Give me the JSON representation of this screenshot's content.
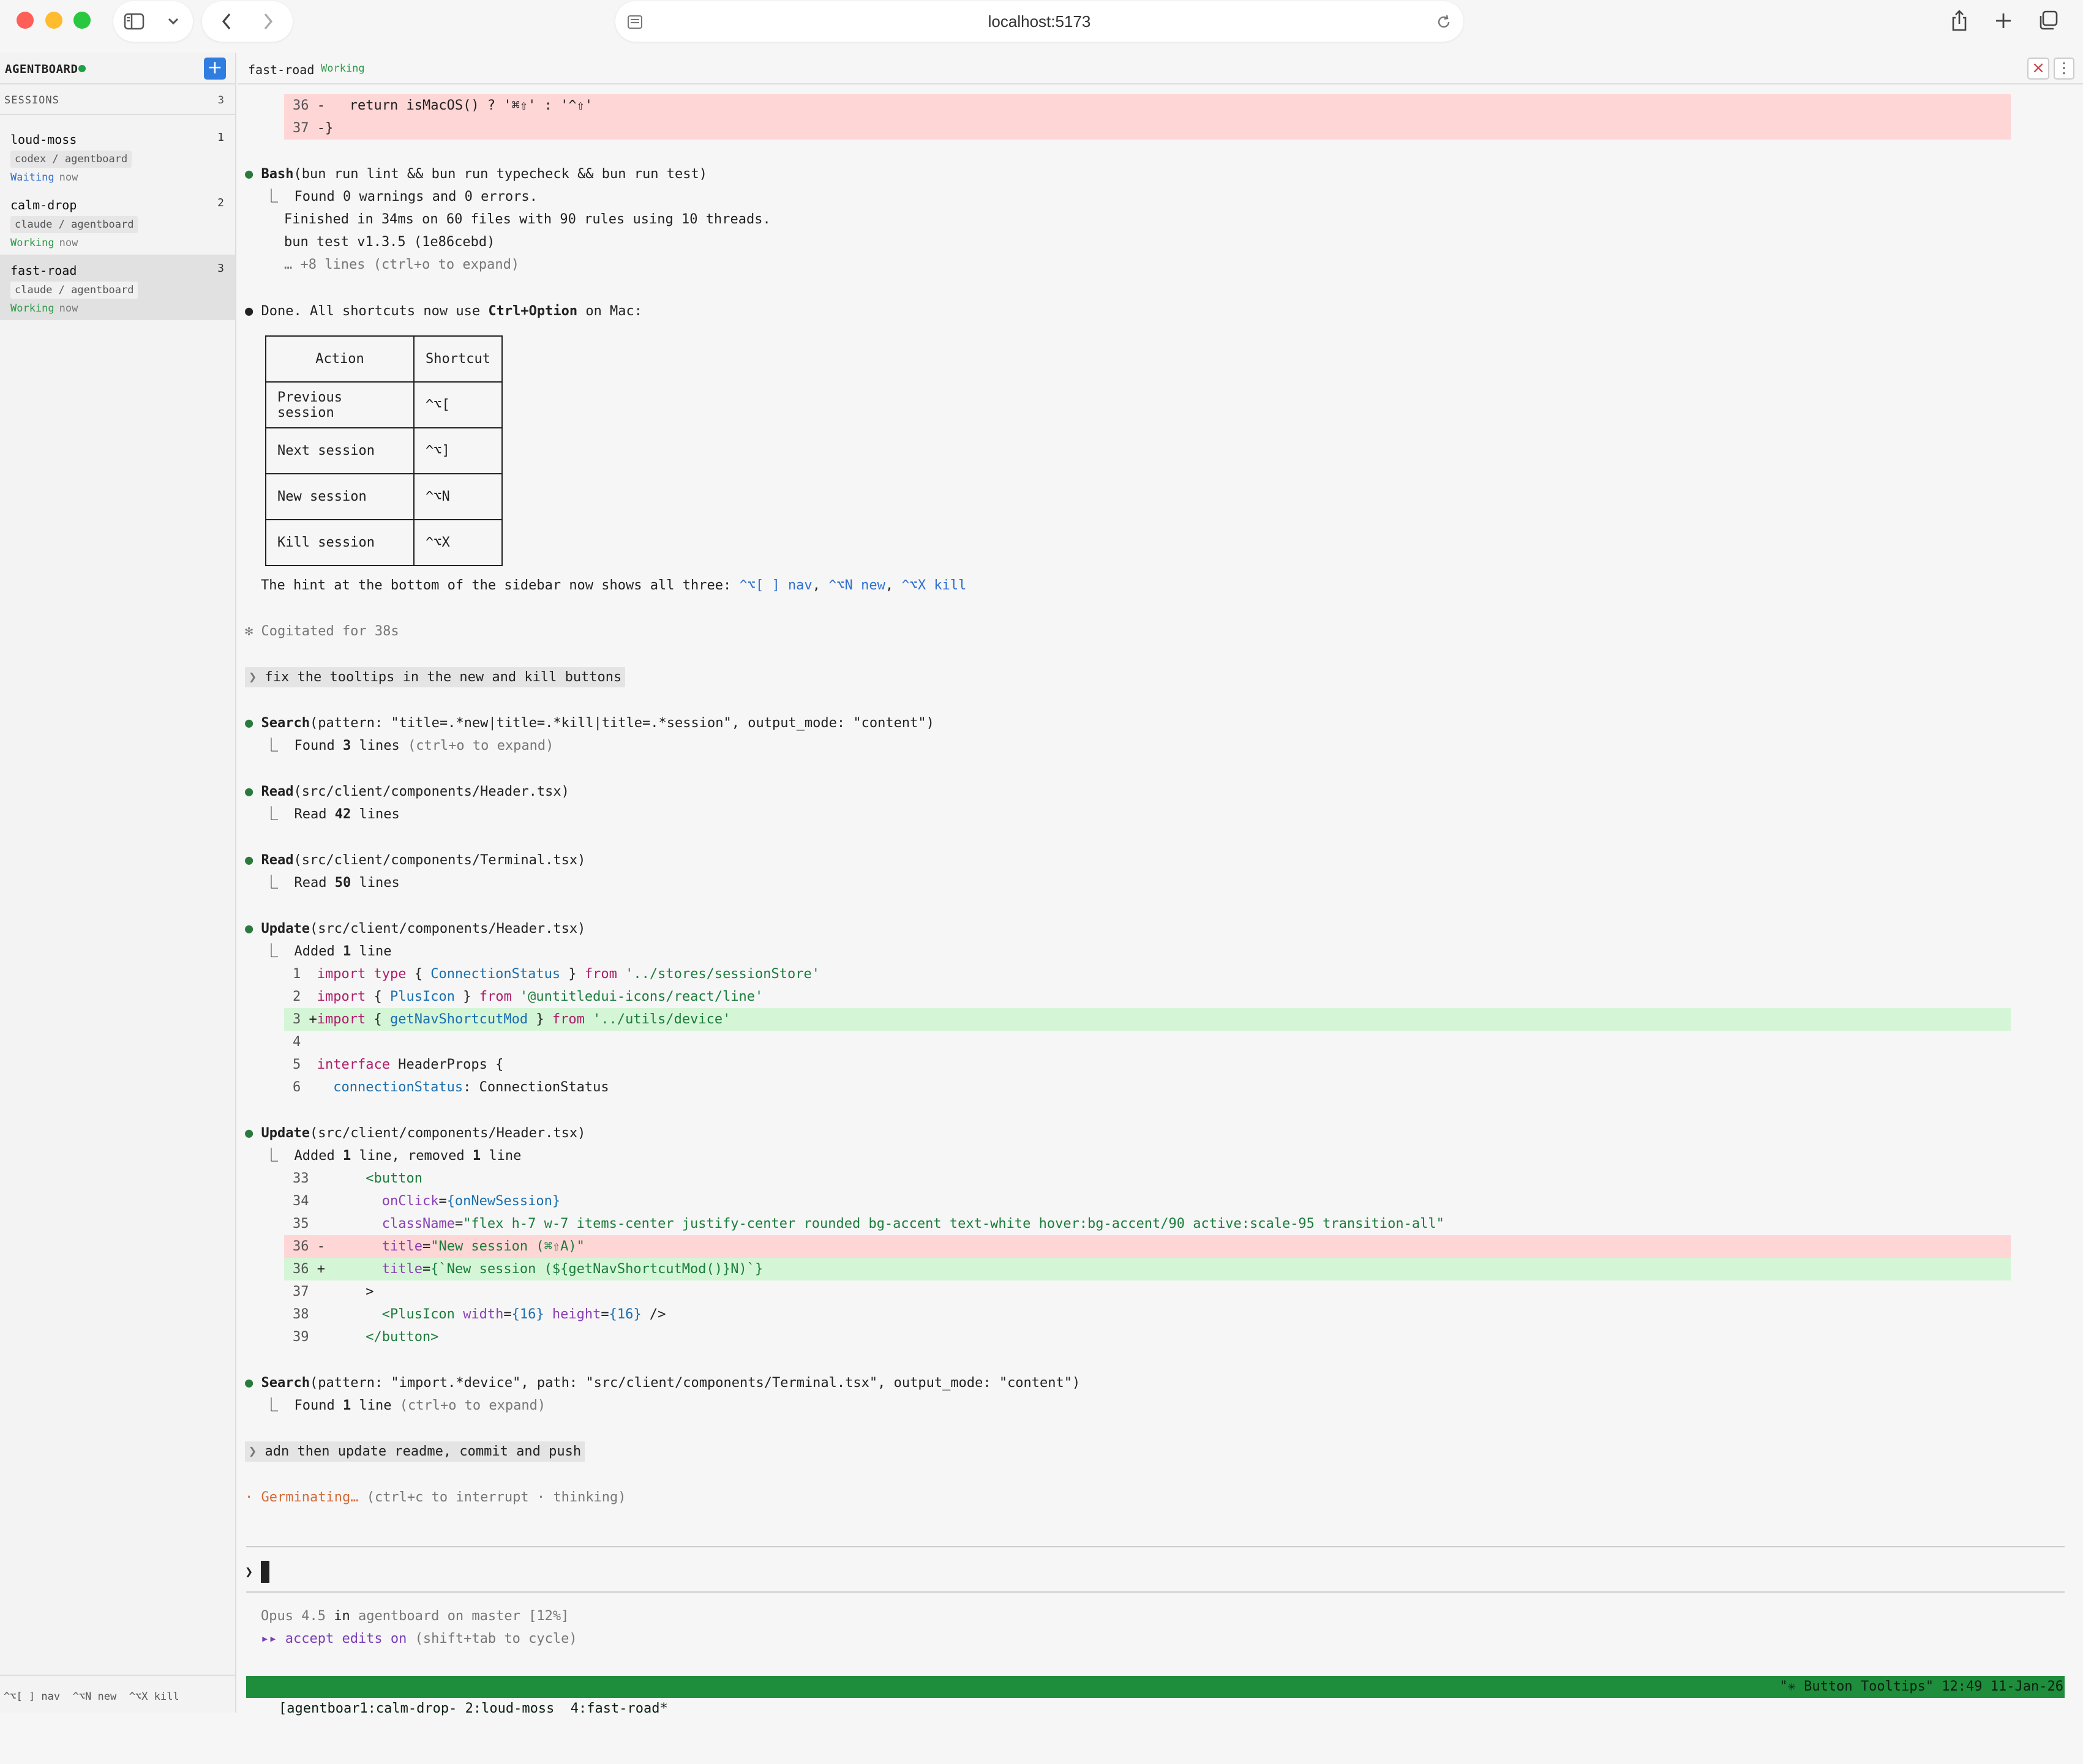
{
  "browser": {
    "url": "localhost:5173"
  },
  "sidebar": {
    "brand": "AGENTBOARD",
    "sessions_label": "SESSIONS",
    "sessions_count": "3",
    "sessions": [
      {
        "name": "loud-moss",
        "num": "1",
        "tag": "codex / agentboard",
        "status": "Waiting",
        "time": "now",
        "status_color": "#2f6fcf"
      },
      {
        "name": "calm-drop",
        "num": "2",
        "tag": "claude / agentboard",
        "status": "Working",
        "time": "now",
        "status_color": "#2e9a47"
      },
      {
        "name": "fast-road",
        "num": "3",
        "tag": "claude / agentboard",
        "status": "Working",
        "time": "now",
        "status_color": "#2e9a47"
      }
    ],
    "hint": "^⌥[ ] nav  ^⌥N new  ^⌥X kill"
  },
  "header": {
    "session_name": "fast-road",
    "status": "Working"
  },
  "terminal": {
    "diff_top": [
      {
        "no": "36",
        "sign": "-",
        "code": "  return isMacOS() ? '⌘⇧' : '^⇧'"
      },
      {
        "no": "37",
        "sign": "-",
        "code": "}"
      }
    ],
    "bash": {
      "tool": "Bash",
      "args": "(bun run lint && bun run typecheck && bun run test)",
      "out1": "Found 0 warnings and 0 errors.",
      "out2": "Finished in 34ms on 60 files with 90 rules using 10 threads.",
      "out3": "bun test v1.3.5 (1e86cebd)",
      "out4": "… +8 lines (ctrl+o to expand)"
    },
    "done_pre": "Done. All shortcuts now use ",
    "done_bold": "Ctrl+Option",
    "done_post": " on Mac:",
    "table": {
      "headers": [
        "Action",
        "Shortcut"
      ],
      "rows": [
        [
          "Previous session",
          "^⌥["
        ],
        [
          "Next session",
          "^⌥]"
        ],
        [
          "New session",
          "^⌥N"
        ],
        [
          "Kill session",
          "^⌥X"
        ]
      ]
    },
    "hint_line_pre": "The hint at the bottom of the sidebar now shows all three: ",
    "hint_nav": "^⌥[ ] nav",
    "hint_new": "^⌥N new",
    "hint_kill": "^⌥X kill",
    "cogitated": "✻ Cogitated for 38s",
    "prompt1": "fix the tooltips in the new and kill buttons",
    "search1": {
      "tool": "Search",
      "args": "(pattern: \"title=.*new|title=.*kill|title=.*session\", output_mode: \"content\")",
      "out_pre": "Found ",
      "out_num": "3",
      "out_post": " lines ",
      "out_dim": "(ctrl+o to expand)"
    },
    "read1": {
      "tool": "Read",
      "args": "(src/client/components/Header.tsx)",
      "out_pre": "Read ",
      "out_num": "42",
      "out_post": " lines"
    },
    "read2": {
      "tool": "Read",
      "args": "(src/client/components/Terminal.tsx)",
      "out_pre": "Read ",
      "out_num": "50",
      "out_post": " lines"
    },
    "update1": {
      "tool": "Update",
      "args": "(src/client/components/Header.tsx)",
      "out_pre": "Added ",
      "out_num": "1",
      "out_post": " line",
      "lines": [
        {
          "no": "1",
          "kw1": "import",
          "kw2": "type",
          "p1": " { ",
          "ty": "ConnectionStatus",
          "p2": " } ",
          "kw3": "from",
          "str": "'../stores/sessionStore'"
        },
        {
          "no": "2",
          "kw1": "import",
          "p1": " { ",
          "ty": "PlusIcon",
          "p2": " } ",
          "kw3": "from",
          "str": "'@untitledui-icons/react/line'"
        },
        {
          "no": "3",
          "sign": "+",
          "kw1": "import",
          "p1": " { ",
          "ty": "getNavShortcutMod",
          "p2": " } ",
          "kw3": "from",
          "str": "'../utils/device'"
        },
        {
          "no": "4"
        },
        {
          "no": "5",
          "kw1": "interface",
          "rest": " HeaderProps {"
        },
        {
          "no": "6",
          "ty": "connectionStatus",
          "rest": ": ConnectionStatus"
        }
      ]
    },
    "update2": {
      "tool": "Update",
      "args": "(src/client/components/Header.tsx)",
      "out_pre": "Added ",
      "out_num": "1",
      "out_mid": " line, removed ",
      "out_num2": "1",
      "out_post": " line",
      "l33": {
        "no": "33",
        "code": "<button"
      },
      "l34": {
        "no": "34",
        "attr": "onClick",
        "val": "{onNewSession}"
      },
      "l35": {
        "no": "35",
        "attr": "className",
        "val": "\"flex h-7 w-7 items-center justify-center rounded bg-accent text-white hover:bg-accent/90 active:scale-95 transition-all\""
      },
      "l36a": {
        "no": "36",
        "sign": "-",
        "attr": "title",
        "val": "\"New session (⌘⇧A)\""
      },
      "l36b": {
        "no": "36",
        "sign": "+",
        "attr": "title",
        "val": "{`New session (${getNavShortcutMod()}N)`}"
      },
      "l37": {
        "no": "37",
        "code": ">"
      },
      "l38": {
        "no": "38",
        "tag": "<PlusIcon",
        "a1": "width",
        "v1": "{16}",
        "a2": "height",
        "v2": "{16}",
        "end": " />"
      },
      "l39": {
        "no": "39",
        "code": "</button>"
      }
    },
    "search2": {
      "tool": "Search",
      "args": "(pattern: \"import.*device\", path: \"src/client/components/Terminal.tsx\", output_mode: \"content\")",
      "out_pre": "Found ",
      "out_num": "1",
      "out_post": " line ",
      "out_dim": "(ctrl+o to expand)"
    },
    "prompt2": "adn then update readme, commit and push",
    "germ_word": "Germinating…",
    "germ_rest": " (ctrl+c to interrupt · thinking)",
    "model": "Opus 4.5",
    "model_in": " in ",
    "model_rest": "agentboard on master [12%]",
    "accept_pre": "▸▸ accept edits on",
    "accept_post": " (shift+tab to cycle)",
    "tmux_left": "[agentboar1:calm-drop- 2:loud-moss  4:fast-road*",
    "tmux_right": "\"✳ Button Tooltips\" 12:49 11-Jan-26"
  }
}
